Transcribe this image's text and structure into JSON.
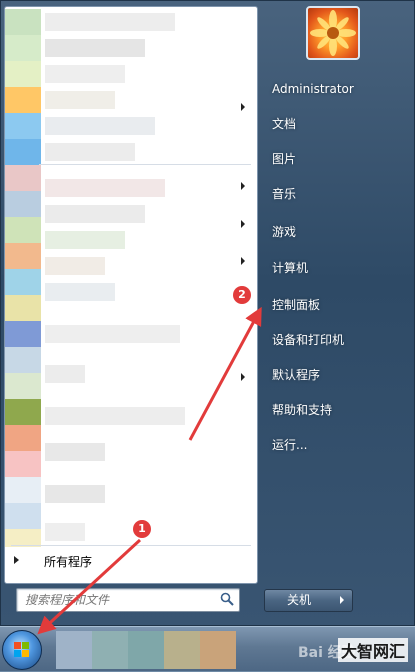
{
  "user": {
    "name": "Administrator"
  },
  "right_menu": {
    "items": [
      {
        "label": "Administrator"
      },
      {
        "label": "文档"
      },
      {
        "label": "图片"
      },
      {
        "label": "音乐"
      },
      {
        "label": "游戏"
      },
      {
        "label": "计算机"
      },
      {
        "label": "控制面板"
      },
      {
        "label": "设备和打印机"
      },
      {
        "label": "默认程序"
      },
      {
        "label": "帮助和支持"
      },
      {
        "label": "运行..."
      }
    ]
  },
  "left_menu": {
    "all_programs_label": "所有程序",
    "search_placeholder": "搜索程序和文件"
  },
  "shutdown": {
    "label": "关机"
  },
  "annotations": [
    {
      "number": "1"
    },
    {
      "number": "2"
    }
  ],
  "watermark": {
    "logo_text": "Bai 经验",
    "site_text": "大智网汇"
  },
  "colors": {
    "annotation_red": "#e23b3b",
    "menu_dark_blue": "#2e4a66"
  }
}
